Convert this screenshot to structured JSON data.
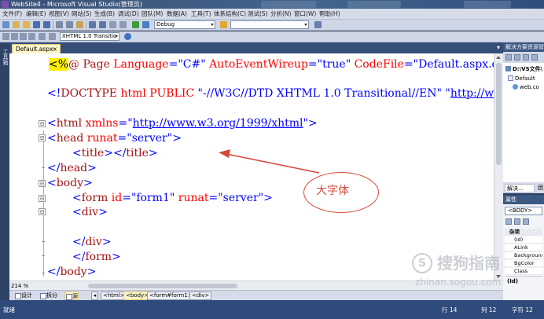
{
  "window": {
    "title": "WebSite4 - Microsoft Visual Studio(管理员)"
  },
  "menu": [
    "文件(F)",
    "编辑(E)",
    "视图(V)",
    "网站(S)",
    "生成(B)",
    "调试(D)",
    "团队(M)",
    "数据(A)",
    "工具(T)",
    "体系结构(C)",
    "测试(S)",
    "分析(N)",
    "窗口(W)",
    "帮助(H)"
  ],
  "toolbar": {
    "config": "Debug",
    "platform": "",
    "doctype": "XHTML 1.0 Transitio"
  },
  "left_strip_label": "工具箱",
  "doc_tab": {
    "name": "Default.aspx",
    "close": "×"
  },
  "code": {
    "l1": {
      "open": "<%",
      "k1": "@ Page ",
      "a1": "Language",
      "eq1": "=",
      "v1": "\"C#\"",
      "a2": " AutoEventWireup",
      "eq2": "=",
      "v2": "\"true\"",
      "a3": " CodeFile",
      "eq3": "=",
      "v3": "\"Default.aspx.cs\""
    },
    "l2": {
      "lt": "<!",
      "tag": "DOCTYPE",
      "rest": " html PUBLIC ",
      "v1": "\"-//W3C//DTD XHTML 1.0 Transitional//EN\"",
      "sp": " ",
      "q": "\"",
      "link": "http://ww"
    },
    "l3": {
      "lt": "<",
      "tag": "html",
      "attr": " xmlns",
      "eq": "=",
      "q1": "\"",
      "link": "http://www.w3.org/1999/xhtml",
      "q2": "\"",
      "gt": ">"
    },
    "l4": {
      "lt": "<",
      "tag": "head",
      "attr": " runat",
      "eq": "=",
      "val": "\"server\"",
      "gt": ">"
    },
    "l5": {
      "lt": "<",
      "tag": "title",
      "mid": "></",
      "tag2": "title",
      "gt": ">"
    },
    "l6": {
      "lt": "</",
      "tag": "head",
      "gt": ">"
    },
    "l7": {
      "lt": "<",
      "tag": "body",
      "gt": ">"
    },
    "l8": {
      "lt": "<",
      "tag": "form",
      "attr1": " id",
      "eq1": "=",
      "val1": "\"form1\"",
      "attr2": " runat",
      "eq2": "=",
      "val2": "\"server\"",
      "gt": ">"
    },
    "l9": {
      "lt": "<",
      "tag": "div",
      "gt": ">"
    },
    "l10": {
      "lt": "</",
      "tag": "div",
      "gt": ">"
    },
    "l11": {
      "lt": "</",
      "tag": "form",
      "gt": ">"
    },
    "l12": {
      "lt": "</",
      "tag": "body",
      "gt": ">"
    }
  },
  "fold_markers": [
    "⊟",
    "⊟",
    "⊟",
    "⊟",
    "⊟"
  ],
  "annotation": {
    "text": "大字体",
    "color": "#d74a3a"
  },
  "zoom": "214 %",
  "view_buttons": [
    "设计",
    "拆分",
    "源"
  ],
  "breadcrumb": [
    "<html>",
    "<body>",
    "<form#form1>",
    "<div>"
  ],
  "solution_explorer": {
    "title": "解决方案资源管理器",
    "items": [
      "D:\\VS文件\\",
      "Default",
      "web.co"
    ],
    "tabs": [
      "解决...",
      "团"
    ]
  },
  "properties": {
    "title": "属性",
    "selected": "<BODY>",
    "category": "杂项",
    "rows": [
      "(Id)",
      "ALink",
      "Background",
      "BgColor",
      "Class"
    ],
    "description": "(Id)"
  },
  "status": {
    "ready": "就绪",
    "line": "行 14",
    "col": "列 12",
    "ch": "字符 12"
  },
  "watermark": {
    "logo": "S",
    "text": "搜狗指南",
    "url": "zhinan.sogou.com"
  },
  "colors": {
    "ide_frame": "#2b3c59",
    "keyword_blue": "#0000ff",
    "tag_maroon": "#a31515",
    "attr_red": "#ff0000",
    "directive_highlight": "#ffee00"
  }
}
